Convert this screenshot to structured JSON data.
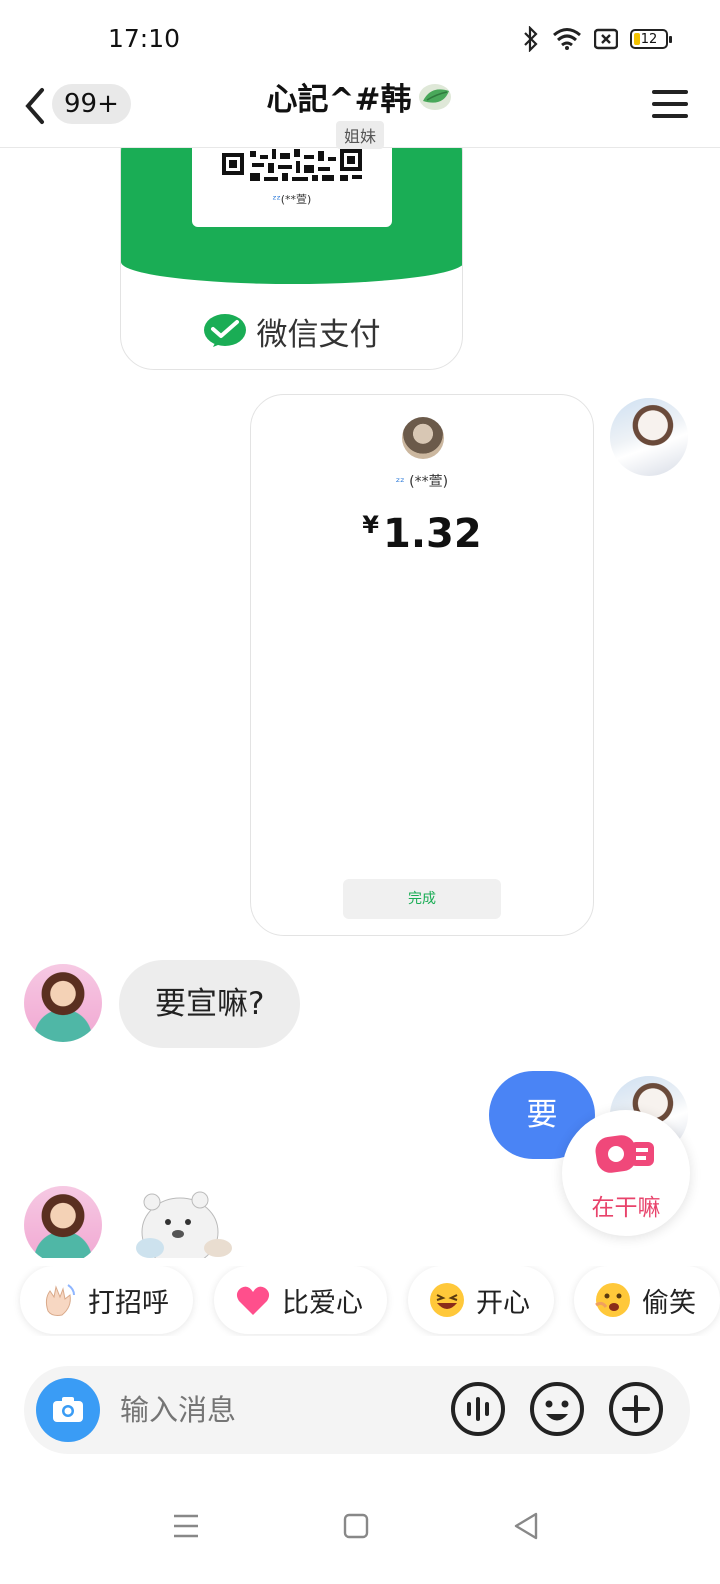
{
  "status_bar": {
    "time": "17:10",
    "battery": "12"
  },
  "header": {
    "back_icon": "chevron-left-icon",
    "unread_count": "99+",
    "title": "心記^#韩",
    "relation_tag": "姐妹",
    "menu_icon": "hamburger-menu-icon"
  },
  "messages": {
    "wechat_qr_card": {
      "payee_label": "(**萱)",
      "footer": "微信支付"
    },
    "payment_receipt": {
      "payee": "(**萱)",
      "currency": "¥",
      "amount": "1.32",
      "done_button": "完成"
    },
    "incoming_text": "要宣嘛?",
    "outgoing_text": "要"
  },
  "floating_action": {
    "label": "在干嘛"
  },
  "quick_reactions": [
    {
      "label": "打招呼",
      "icon": "waving-hand-icon"
    },
    {
      "label": "比爱心",
      "icon": "pink-heart-icon"
    },
    {
      "label": "开心",
      "icon": "laughing-face-icon"
    },
    {
      "label": "偷笑",
      "icon": "giggling-face-icon"
    }
  ],
  "composer": {
    "placeholder": "输入消息",
    "camera_icon": "camera-icon",
    "voice_icon": "voice-wave-icon",
    "emoji_icon": "smiley-icon",
    "plus_icon": "plus-circle-icon"
  },
  "colors": {
    "accent_blue": "#4a84f5",
    "wechat_green": "#1aad55",
    "fab_pink": "#e8436b"
  }
}
